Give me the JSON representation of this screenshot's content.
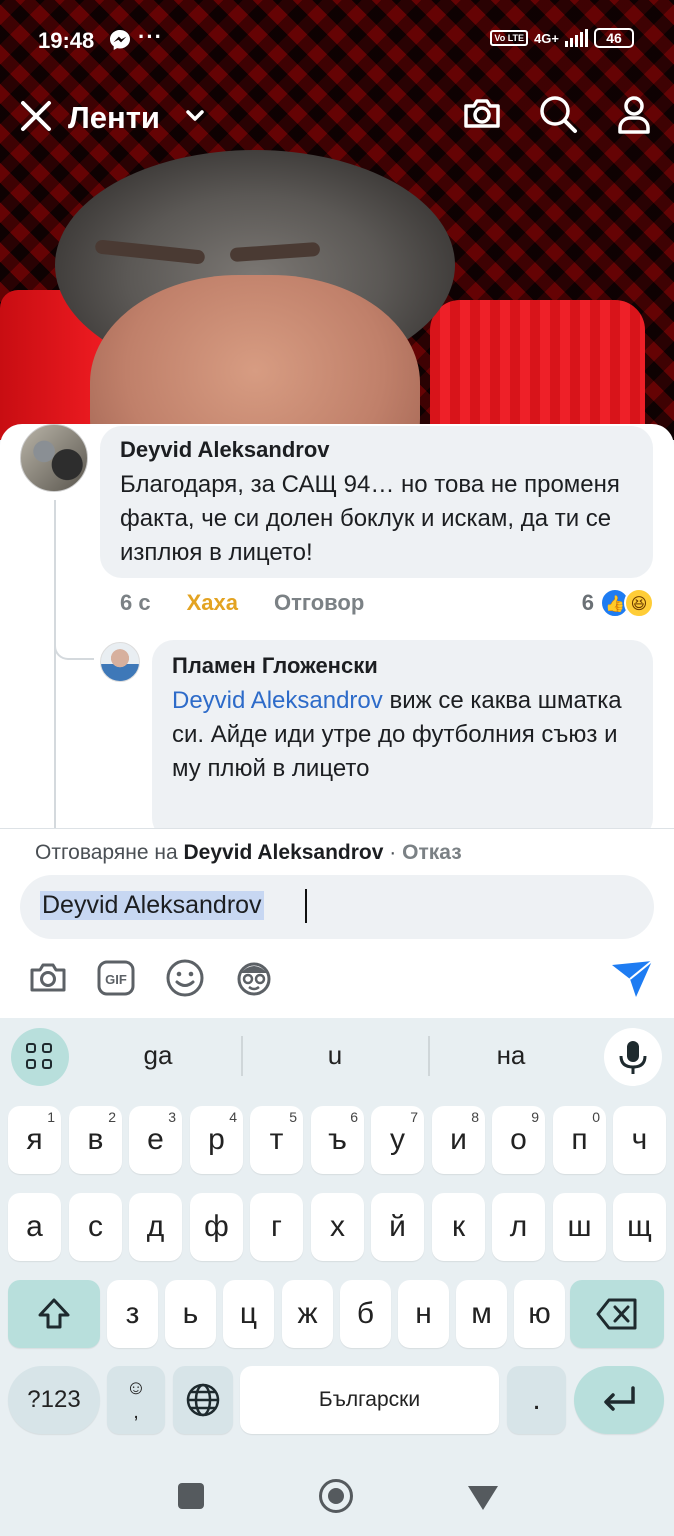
{
  "statusbar": {
    "time": "19:48",
    "messenger_icon": "messenger-icon",
    "more": "···",
    "volte": "Vo LTE",
    "network": "4G+",
    "battery": "46"
  },
  "topbar": {
    "title": "Ленти",
    "icons": [
      "close-icon",
      "chevron-down-icon",
      "camera-icon",
      "search-icon",
      "profile-icon"
    ]
  },
  "comments": [
    {
      "author": "Deyvid Aleksandrov",
      "text": "Благодаря, за САЩ 94… но това не променя факта, че си долен боклук и искам, да ти се изплюя в лицето!",
      "time": "6 с",
      "reaction_label": "Хаха",
      "reply_label": "Отговор",
      "reaction_count": "6"
    },
    {
      "author": "Пламен Гложенски",
      "mention": "Deyvid Aleksandrov",
      "text": " виж се каква шматка си. Айде иди утре до футболния съюз и му плюй в лицето"
    }
  ],
  "composer": {
    "replying_prefix": "Отговаряне на ",
    "replying_to": "Deyvid Aleksandrov",
    "separator": " · ",
    "cancel": "Отказ",
    "input_value": "Deyvid Aleksandrov",
    "send_color": "#1e7cf2"
  },
  "keyboard": {
    "suggestions": [
      "ga",
      "u",
      "на"
    ],
    "row1": [
      {
        "k": "я",
        "n": "1"
      },
      {
        "k": "в",
        "n": "2"
      },
      {
        "k": "е",
        "n": "3"
      },
      {
        "k": "р",
        "n": "4"
      },
      {
        "k": "т",
        "n": "5"
      },
      {
        "k": "ъ",
        "n": "6"
      },
      {
        "k": "у",
        "n": "7"
      },
      {
        "k": "и",
        "n": "8"
      },
      {
        "k": "о",
        "n": "9"
      },
      {
        "k": "п",
        "n": "0"
      },
      {
        "k": "ч",
        "n": ""
      }
    ],
    "row2": [
      "а",
      "с",
      "д",
      "ф",
      "г",
      "х",
      "й",
      "к",
      "л",
      "ш",
      "щ"
    ],
    "row3": [
      "з",
      "ь",
      "ц",
      "ж",
      "б",
      "н",
      "м",
      "ю"
    ],
    "symbols": "?123",
    "emoji_comma": "☺\n,",
    "space": "Български",
    "period": "."
  },
  "colors": {
    "accent": "#1e7cf2",
    "haha": "#e3a322",
    "mention": "#2d6bc9",
    "keyboard_accent": "#b8dfdc"
  }
}
